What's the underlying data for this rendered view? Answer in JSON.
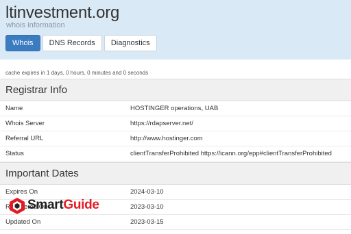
{
  "site": {
    "title": "ltinvestment.org",
    "subtitle": "whois information"
  },
  "tabs": [
    {
      "label": "Whois",
      "active": true
    },
    {
      "label": "DNS Records",
      "active": false
    },
    {
      "label": "Diagnostics",
      "active": false
    }
  ],
  "cache_text": "cache expires in 1 days, 0 hours, 0 minutes and 0 seconds",
  "registrar": {
    "heading": "Registrar Info",
    "rows": [
      {
        "key": "Name",
        "value": "HOSTINGER operations, UAB"
      },
      {
        "key": "Whois Server",
        "value": "https://rdapserver.net/"
      },
      {
        "key": "Referral URL",
        "value": "http://www.hostinger.com"
      },
      {
        "key": "Status",
        "value": "clientTransferProhibited https://icann.org/epp#clientTransferProhibited"
      }
    ]
  },
  "dates": {
    "heading": "Important Dates",
    "rows": [
      {
        "key": "Expires On",
        "value": "2024-03-10"
      },
      {
        "key": "Registered On",
        "value": "2023-03-10"
      },
      {
        "key": "Updated On",
        "value": "2023-03-15"
      }
    ]
  },
  "watermark": {
    "part1": "Smart",
    "part2": "Guide",
    "colors": {
      "dark": "#222222",
      "red": "#e31b23"
    }
  },
  "colors": {
    "header_bg": "#d9eaf6",
    "active_tab": "#3b7bbf",
    "section_bg": "#f0f0f0"
  }
}
